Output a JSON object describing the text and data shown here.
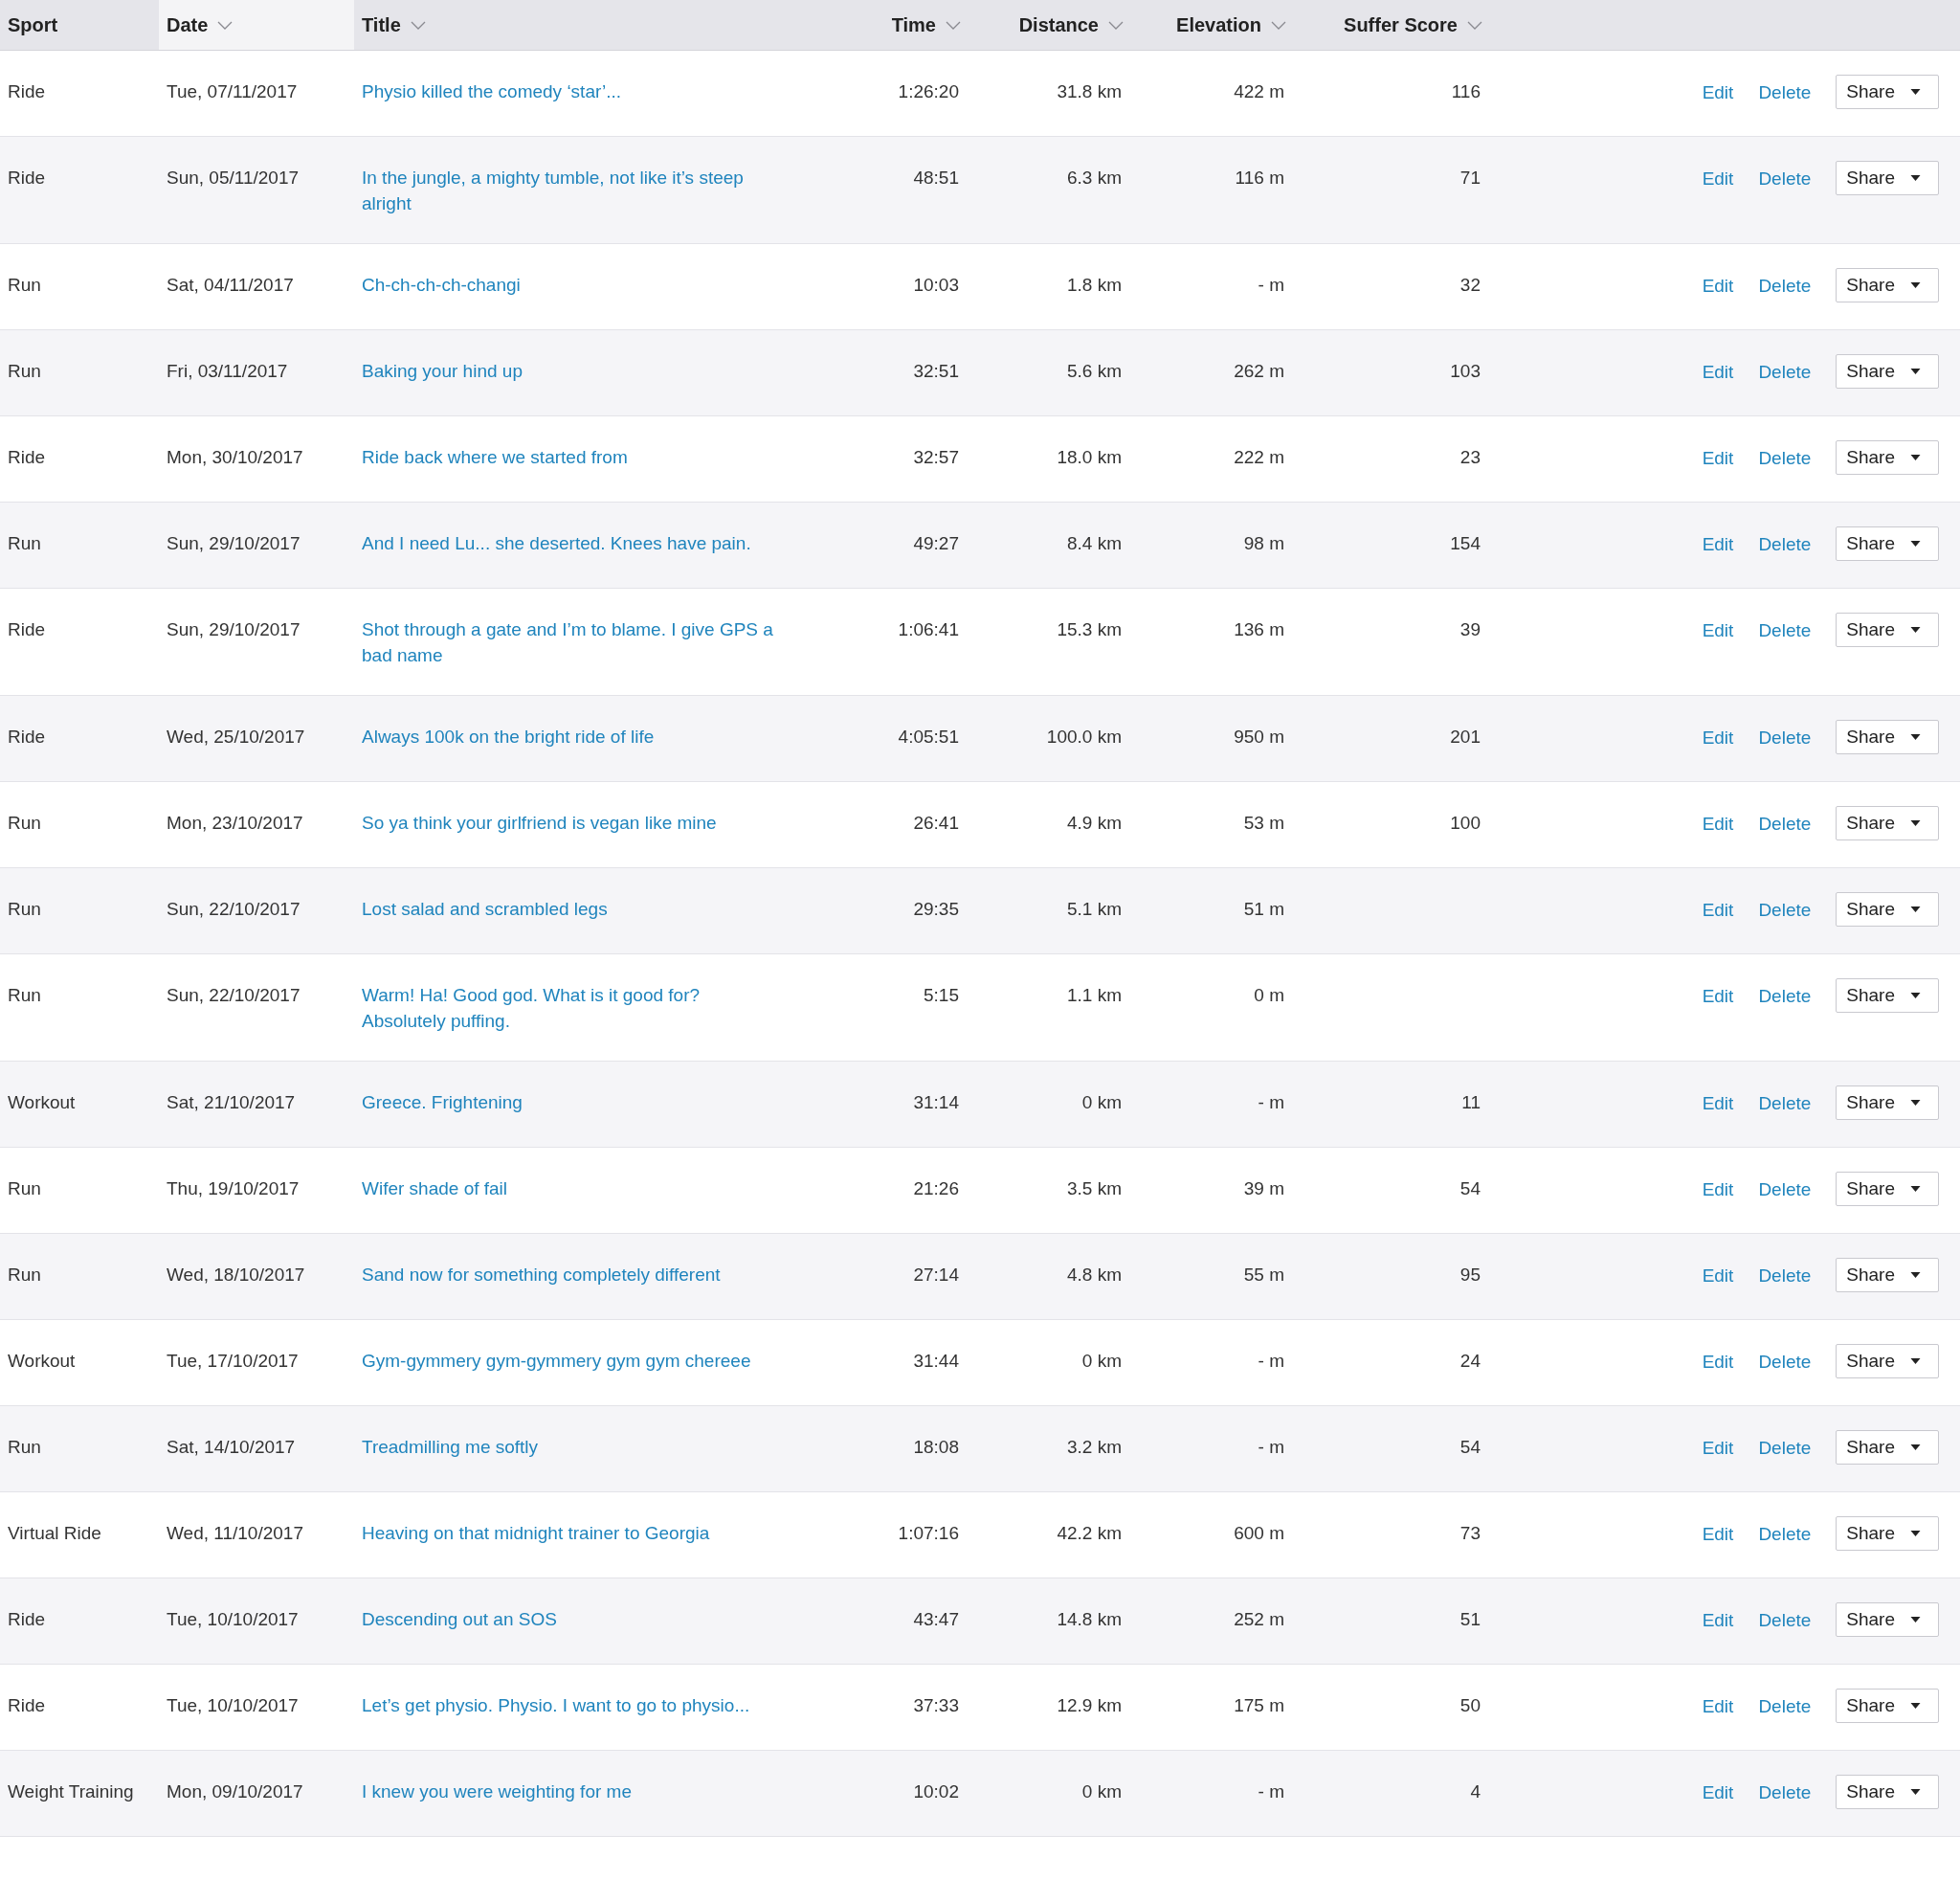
{
  "table": {
    "columns": [
      {
        "label": "Sport",
        "sortable": false,
        "selected": false
      },
      {
        "label": "Date",
        "sortable": true,
        "selected": true
      },
      {
        "label": "Title",
        "sortable": true,
        "selected": false
      },
      {
        "label": "Time",
        "sortable": true,
        "selected": false
      },
      {
        "label": "Distance",
        "sortable": true,
        "selected": false
      },
      {
        "label": "Elevation",
        "sortable": true,
        "selected": false
      },
      {
        "label": "Suffer Score",
        "sortable": true,
        "selected": false
      }
    ],
    "rows": [
      {
        "sport": "Ride",
        "date": "Tue, 07/11/2017",
        "title": "Physio killed the comedy ‘star’...",
        "time": "1:26:20",
        "distance": "31.8 km",
        "elevation": "422 m",
        "suffer_score": "116",
        "edit": "Edit",
        "delete": "Delete",
        "share": "Share"
      },
      {
        "sport": "Ride",
        "date": "Sun, 05/11/2017",
        "title": "In the jungle, a mighty tumble, not like it’s steep alright",
        "time": "48:51",
        "distance": "6.3 km",
        "elevation": "116 m",
        "suffer_score": "71",
        "edit": "Edit",
        "delete": "Delete",
        "share": "Share"
      },
      {
        "sport": "Run",
        "date": "Sat, 04/11/2017",
        "title": "Ch-ch-ch-ch-changi",
        "time": "10:03",
        "distance": "1.8 km",
        "elevation": "- m",
        "suffer_score": "32",
        "edit": "Edit",
        "delete": "Delete",
        "share": "Share"
      },
      {
        "sport": "Run",
        "date": "Fri, 03/11/2017",
        "title": "Baking your hind up",
        "time": "32:51",
        "distance": "5.6 km",
        "elevation": "262 m",
        "suffer_score": "103",
        "edit": "Edit",
        "delete": "Delete",
        "share": "Share"
      },
      {
        "sport": "Ride",
        "date": "Mon, 30/10/2017",
        "title": "Ride back where we started from",
        "time": "32:57",
        "distance": "18.0 km",
        "elevation": "222 m",
        "suffer_score": "23",
        "edit": "Edit",
        "delete": "Delete",
        "share": "Share"
      },
      {
        "sport": "Run",
        "date": "Sun, 29/10/2017",
        "title": "And I need Lu... she deserted. Knees have pain.",
        "time": "49:27",
        "distance": "8.4 km",
        "elevation": "98 m",
        "suffer_score": "154",
        "edit": "Edit",
        "delete": "Delete",
        "share": "Share"
      },
      {
        "sport": "Ride",
        "date": "Sun, 29/10/2017",
        "title": "Shot through a gate and I’m to blame. I give GPS a bad name",
        "time": "1:06:41",
        "distance": "15.3 km",
        "elevation": "136 m",
        "suffer_score": "39",
        "edit": "Edit",
        "delete": "Delete",
        "share": "Share"
      },
      {
        "sport": "Ride",
        "date": "Wed, 25/10/2017",
        "title": "Always 100k on the bright ride of life",
        "time": "4:05:51",
        "distance": "100.0 km",
        "elevation": "950 m",
        "suffer_score": "201",
        "edit": "Edit",
        "delete": "Delete",
        "share": "Share"
      },
      {
        "sport": "Run",
        "date": "Mon, 23/10/2017",
        "title": "So ya think your girlfriend is vegan like mine",
        "time": "26:41",
        "distance": "4.9 km",
        "elevation": "53 m",
        "suffer_score": "100",
        "edit": "Edit",
        "delete": "Delete",
        "share": "Share"
      },
      {
        "sport": "Run",
        "date": "Sun, 22/10/2017",
        "title": "Lost salad and scrambled legs",
        "time": "29:35",
        "distance": "5.1 km",
        "elevation": "51 m",
        "edit": "Edit",
        "delete": "Delete",
        "share": "Share"
      },
      {
        "sport": "Run",
        "date": "Sun, 22/10/2017",
        "title": "Warm! Ha! Good god. What is it good for? Absolutely puffing.",
        "time": "5:15",
        "distance": "1.1 km",
        "elevation": "0 m",
        "edit": "Edit",
        "delete": "Delete",
        "share": "Share"
      },
      {
        "sport": "Workout",
        "date": "Sat, 21/10/2017",
        "title": "Greece. Frightening",
        "time": "31:14",
        "distance": "0 km",
        "elevation": "- m",
        "suffer_score": "11",
        "edit": "Edit",
        "delete": "Delete",
        "share": "Share"
      },
      {
        "sport": "Run",
        "date": "Thu, 19/10/2017",
        "title": "Wifer shade of fail",
        "time": "21:26",
        "distance": "3.5 km",
        "elevation": "39 m",
        "suffer_score": "54",
        "edit": "Edit",
        "delete": "Delete",
        "share": "Share"
      },
      {
        "sport": "Run",
        "date": "Wed, 18/10/2017",
        "title": "Sand now for something completely different",
        "time": "27:14",
        "distance": "4.8 km",
        "elevation": "55 m",
        "suffer_score": "95",
        "edit": "Edit",
        "delete": "Delete",
        "share": "Share"
      },
      {
        "sport": "Workout",
        "date": "Tue, 17/10/2017",
        "title": "Gym-gymmery gym-gymmery gym gym chereee",
        "time": "31:44",
        "distance": "0 km",
        "elevation": "- m",
        "suffer_score": "24",
        "edit": "Edit",
        "delete": "Delete",
        "share": "Share"
      },
      {
        "sport": "Run",
        "date": "Sat, 14/10/2017",
        "title": "Treadmilling me softly",
        "time": "18:08",
        "distance": "3.2 km",
        "elevation": "- m",
        "suffer_score": "54",
        "edit": "Edit",
        "delete": "Delete",
        "share": "Share"
      },
      {
        "sport": "Virtual Ride",
        "date": "Wed, 11/10/2017",
        "title": "Heaving on that midnight trainer to Georgia",
        "time": "1:07:16",
        "distance": "42.2 km",
        "elevation": "600 m",
        "suffer_score": "73",
        "edit": "Edit",
        "delete": "Delete",
        "share": "Share"
      },
      {
        "sport": "Ride",
        "date": "Tue, 10/10/2017",
        "title": "Descending out an SOS",
        "time": "43:47",
        "distance": "14.8 km",
        "elevation": "252 m",
        "suffer_score": "51",
        "edit": "Edit",
        "delete": "Delete",
        "share": "Share"
      },
      {
        "sport": "Ride",
        "date": "Tue, 10/10/2017",
        "title": "Let’s get physio. Physio. I want to go to physio...",
        "time": "37:33",
        "distance": "12.9 km",
        "elevation": "175 m",
        "suffer_score": "50",
        "edit": "Edit",
        "delete": "Delete",
        "share": "Share"
      },
      {
        "sport": "Weight Training",
        "date": "Mon, 09/10/2017",
        "title": "I knew you were weighting for me",
        "time": "10:02",
        "distance": "0 km",
        "elevation": "- m",
        "suffer_score": "4",
        "edit": "Edit",
        "delete": "Delete",
        "share": "Share"
      }
    ]
  }
}
